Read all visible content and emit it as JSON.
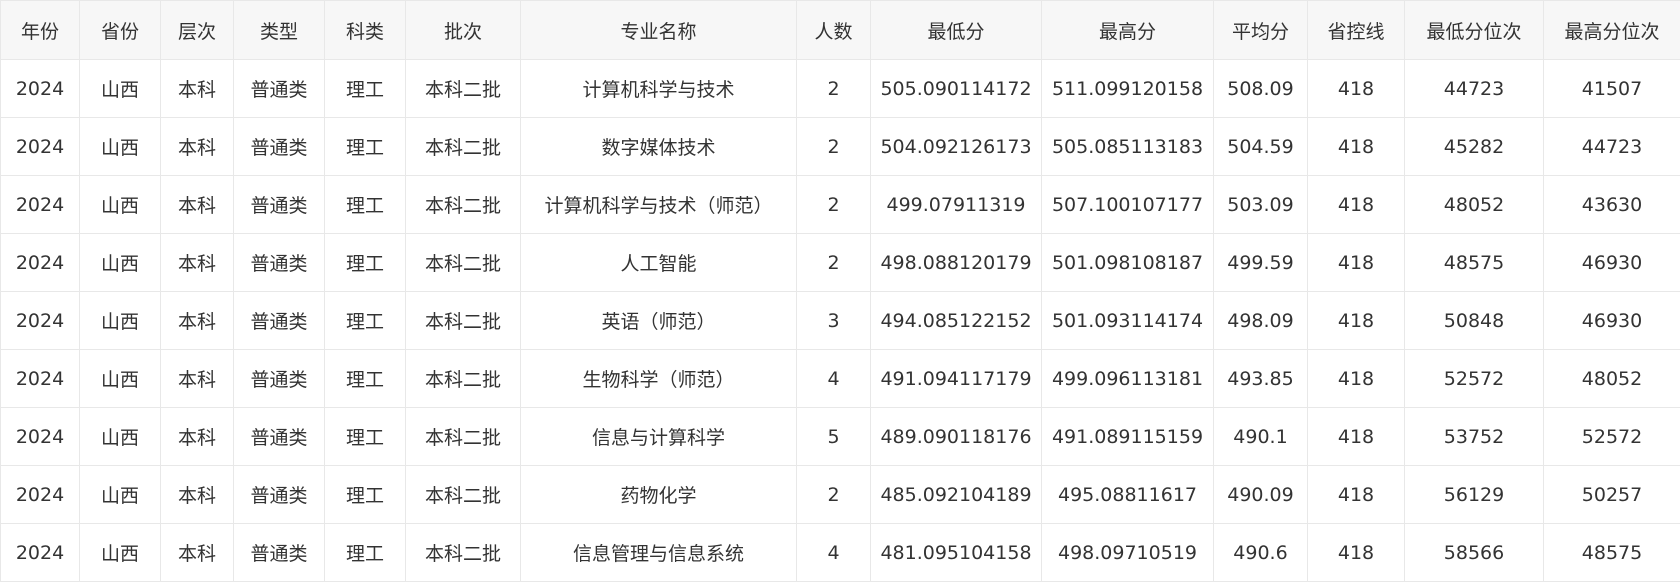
{
  "table": {
    "headers": [
      "年份",
      "省份",
      "层次",
      "类型",
      "科类",
      "批次",
      "专业名称",
      "人数",
      "最低分",
      "最高分",
      "平均分",
      "省控线",
      "最低分位次",
      "最高分位次"
    ],
    "rows": [
      [
        "2024",
        "山西",
        "本科",
        "普通类",
        "理工",
        "本科二批",
        "计算机科学与技术",
        "2",
        "505.090114172",
        "511.099120158",
        "508.09",
        "418",
        "44723",
        "41507"
      ],
      [
        "2024",
        "山西",
        "本科",
        "普通类",
        "理工",
        "本科二批",
        "数字媒体技术",
        "2",
        "504.092126173",
        "505.085113183",
        "504.59",
        "418",
        "45282",
        "44723"
      ],
      [
        "2024",
        "山西",
        "本科",
        "普通类",
        "理工",
        "本科二批",
        "计算机科学与技术（师范）",
        "2",
        "499.07911319",
        "507.100107177",
        "503.09",
        "418",
        "48052",
        "43630"
      ],
      [
        "2024",
        "山西",
        "本科",
        "普通类",
        "理工",
        "本科二批",
        "人工智能",
        "2",
        "498.088120179",
        "501.098108187",
        "499.59",
        "418",
        "48575",
        "46930"
      ],
      [
        "2024",
        "山西",
        "本科",
        "普通类",
        "理工",
        "本科二批",
        "英语（师范）",
        "3",
        "494.085122152",
        "501.093114174",
        "498.09",
        "418",
        "50848",
        "46930"
      ],
      [
        "2024",
        "山西",
        "本科",
        "普通类",
        "理工",
        "本科二批",
        "生物科学（师范）",
        "4",
        "491.094117179",
        "499.096113181",
        "493.85",
        "418",
        "52572",
        "48052"
      ],
      [
        "2024",
        "山西",
        "本科",
        "普通类",
        "理工",
        "本科二批",
        "信息与计算科学",
        "5",
        "489.090118176",
        "491.089115159",
        "490.1",
        "418",
        "53752",
        "52572"
      ],
      [
        "2024",
        "山西",
        "本科",
        "普通类",
        "理工",
        "本科二批",
        "药物化学",
        "2",
        "485.092104189",
        "495.08811617",
        "490.09",
        "418",
        "56129",
        "50257"
      ],
      [
        "2024",
        "山西",
        "本科",
        "普通类",
        "理工",
        "本科二批",
        "信息管理与信息系统",
        "4",
        "481.095104158",
        "498.09710519",
        "490.6",
        "418",
        "58566",
        "48575"
      ]
    ]
  }
}
